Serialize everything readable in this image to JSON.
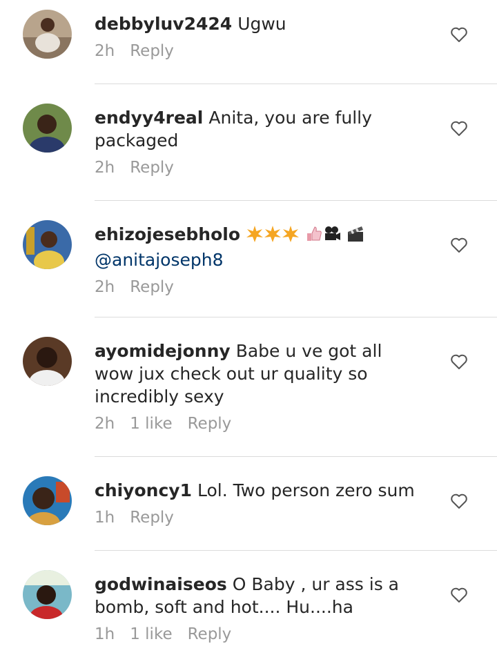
{
  "comments": [
    {
      "username": "debbyluv2424",
      "text": "Ugwu",
      "time": "2h",
      "likes": "",
      "reply": "Reply"
    },
    {
      "username": "endyy4real",
      "text": "Anita, you are fully packaged",
      "time": "2h",
      "likes": "",
      "reply": "Reply"
    },
    {
      "username": "ehizojesebholo",
      "text": "",
      "mention": "@anitajoseph8",
      "emojis": [
        "star-burst",
        "star-burst",
        "star-burst",
        "thumbs-up",
        "movie-camera",
        "clapperboard"
      ],
      "time": "2h",
      "likes": "",
      "reply": "Reply"
    },
    {
      "username": "ayomidejonny",
      "text": "Babe u ve got all wow jux check out ur quality so incredibly sexy",
      "time": "2h",
      "likes": "1 like",
      "reply": "Reply"
    },
    {
      "username": "chiyoncy1",
      "text": "Lol. Two person zero sum",
      "time": "1h",
      "likes": "",
      "reply": "Reply"
    },
    {
      "username": "godwinaiseos",
      "text": "O Baby , ur ass is a bomb, soft and hot.... Hu....ha",
      "time": "1h",
      "likes": "1 like",
      "reply": "Reply"
    }
  ],
  "colors": {
    "username": "#262626",
    "meta": "#999999",
    "mention": "#003569",
    "divider": "#dbdbdb"
  },
  "icons": {
    "like": "heart-outline-icon"
  }
}
